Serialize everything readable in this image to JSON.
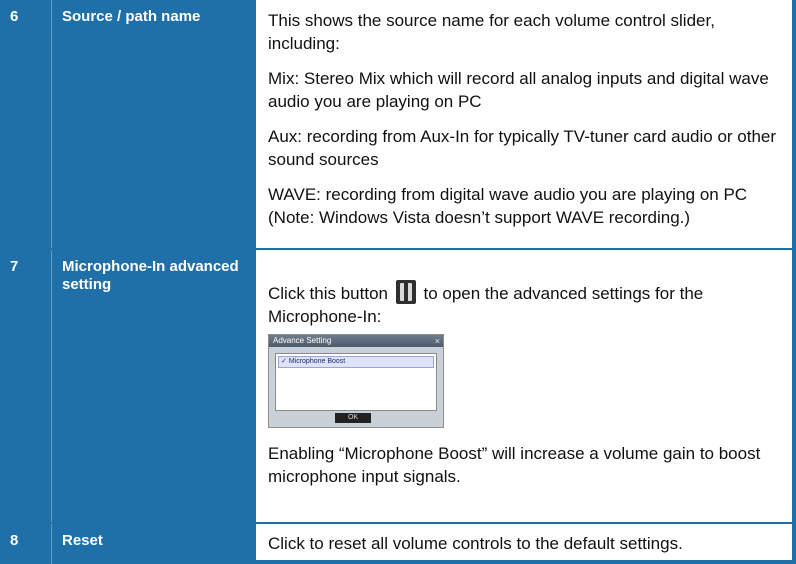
{
  "rows": [
    {
      "number": "6",
      "label": "Source / path name",
      "paragraphs": [
        "This shows the source name for each volume control slider, including:",
        "Mix: Stereo Mix which will record all analog inputs and digital wave audio you are playing on PC",
        "Aux: recording from Aux-In for typically TV-tuner card audio or other sound sources",
        "WAVE: recording from digital wave audio you are playing on PC (Note: Windows Vista doesn’t support WAVE recording.)"
      ]
    },
    {
      "number": "7",
      "label": "Microphone-In advanced setting",
      "text_before_button": "Click this button",
      "text_after_button": "to open the advanced settings for the Microphone-In:",
      "dialog": {
        "title": "Advance Setting",
        "close": "×",
        "option": "Microphone Boost",
        "ok": "OK"
      },
      "note": "Enabling “Microphone Boost” will increase a volume gain to boost microphone input signals."
    },
    {
      "number": "8",
      "label": "Reset",
      "description": "Click to reset all volume controls to the default settings."
    }
  ]
}
